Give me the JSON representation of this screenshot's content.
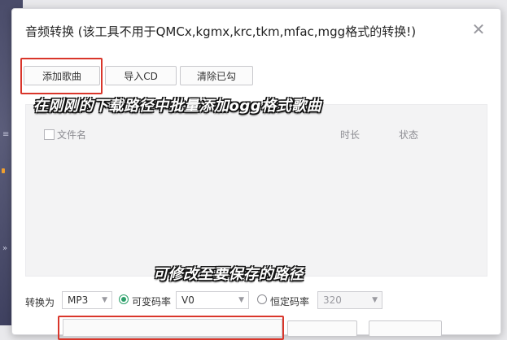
{
  "window": {
    "title": "音频转换 (该工具不用于QMCx,kgmx,krc,tkm,mfac,mgg格式的转换!)"
  },
  "toolbar": {
    "add_song": "添加歌曲",
    "import_cd": "导入CD",
    "clear_done": "清除已勾"
  },
  "list": {
    "columns": {
      "filename": "文件名",
      "duration": "时长",
      "status": "状态"
    }
  },
  "captions": {
    "top": "在刚刚的下载路径中批量添加ogg格式歌曲",
    "bottom": "可修改至要保存的路径"
  },
  "convert": {
    "label": "转换为",
    "format": "MP3",
    "vbr_label": "可变码率",
    "vbr_value": "V0",
    "cbr_label": "恒定码率",
    "cbr_value": "320",
    "selected_mode": "vbr"
  },
  "colors": {
    "highlight": "#d9362b",
    "accent": "#2ca06a"
  },
  "icons": {
    "close": "close-icon",
    "caret": "chevron-down-icon"
  }
}
